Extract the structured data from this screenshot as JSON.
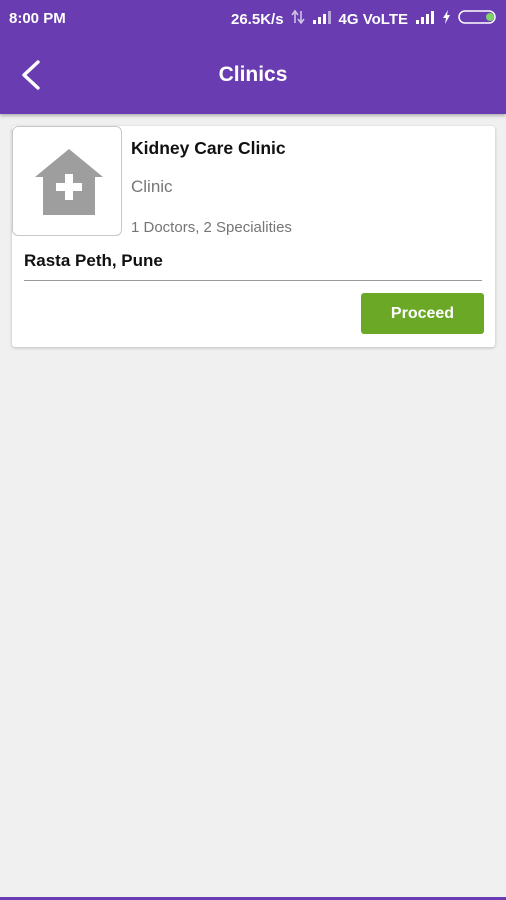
{
  "status_bar": {
    "time": "8:00 PM",
    "speed": "26.5K/s",
    "network": "4G VoLTE",
    "icons": [
      "data-arrows-icon",
      "signal-icon",
      "signal-icon",
      "charging-icon",
      "battery-icon"
    ]
  },
  "app_bar": {
    "back_icon": "chevron-left-icon",
    "title": "Clinics"
  },
  "clinic": {
    "image_icon": "hospital-icon",
    "name": "Kidney Care Clinic",
    "type": "Clinic",
    "stats": "1 Doctors, 2 Specialities",
    "location": "Rasta Peth, Pune",
    "proceed_label": "Proceed"
  },
  "colors": {
    "primary": "#6a3cb2",
    "accent_green": "#6aa825",
    "background": "#f0f0f0"
  }
}
